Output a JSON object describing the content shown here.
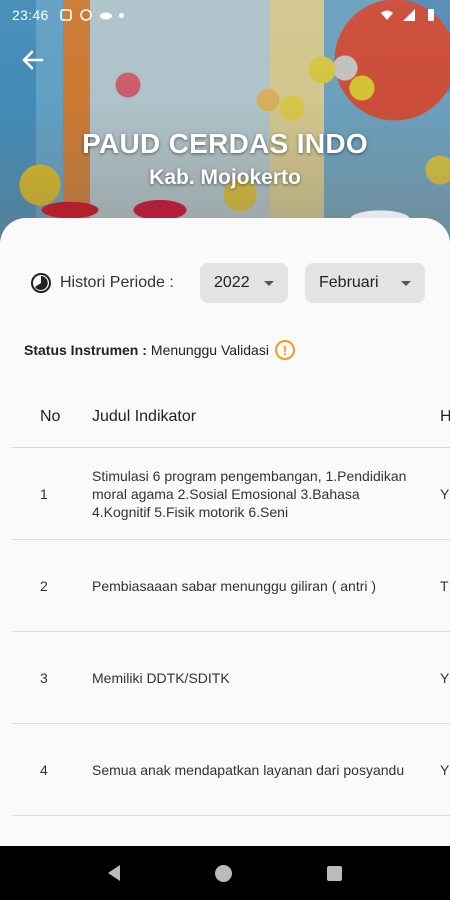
{
  "status_bar": {
    "time": "23:46"
  },
  "header": {
    "title": "PAUD CERDAS INDO",
    "subtitle": "Kab. Mojokerto"
  },
  "period": {
    "label": "Histori Periode :",
    "year": "2022",
    "month": "Februari"
  },
  "status": {
    "label": "Status Instrumen :",
    "value": "Menunggu Validasi"
  },
  "table": {
    "headers": [
      "No",
      "Judul Indikator",
      "H"
    ],
    "rows": [
      {
        "no": "1",
        "judul": "Stimulasi 6 program pengembangan, 1.Pendidikan moral agama 2.Sosial Emosional 3.Bahasa 4.Kognitif 5.Fisik motorik 6.Seni",
        "h": "Y"
      },
      {
        "no": "2",
        "judul": "Pembiasaaan sabar menunggu giliran ( antri )",
        "h": "T"
      },
      {
        "no": "3",
        "judul": "Memiliki DDTK/SDITK",
        "h": "Y"
      },
      {
        "no": "4",
        "judul": "Semua anak mendapatkan layanan dari posyandu",
        "h": "Y"
      }
    ]
  },
  "colors": {
    "accent": "#f39a1d",
    "card": "#fafafa",
    "dropdown": "#e3e3e3"
  }
}
